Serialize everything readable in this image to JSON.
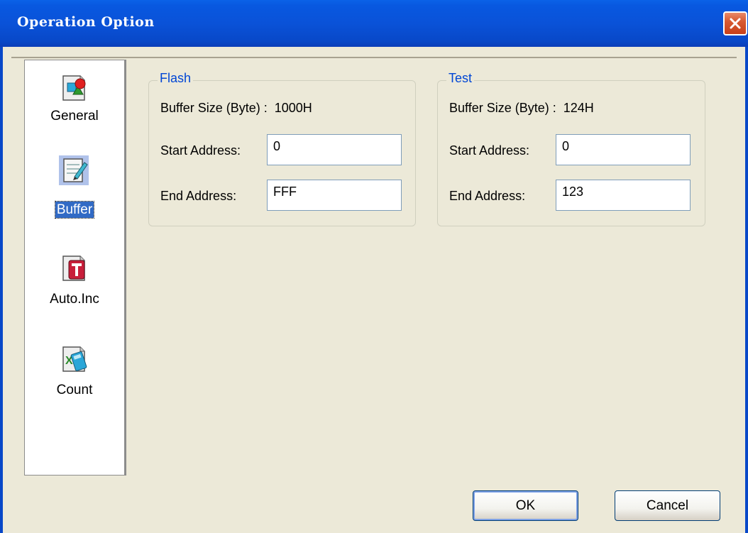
{
  "window": {
    "title": "Operation Option",
    "close_icon": "close-icon"
  },
  "sidebar": {
    "items": [
      {
        "label": "General",
        "icon": "shapes-icon",
        "selected": false
      },
      {
        "label": "Buffer",
        "icon": "notepad-pencil-icon",
        "selected": true
      },
      {
        "label": "Auto.Inc",
        "icon": "letter-t-icon",
        "selected": false
      },
      {
        "label": "Count",
        "icon": "spreadsheet-calculator-icon",
        "selected": false
      }
    ]
  },
  "flash": {
    "title": "Flash",
    "buffer_size_label": "Buffer Size (Byte) :",
    "buffer_size_value": "1000H",
    "start_label": "Start Address:",
    "start_value": "0",
    "end_label": "End Address:",
    "end_value": "FFF"
  },
  "test": {
    "title": "Test",
    "buffer_size_label": "Buffer Size (Byte) :",
    "buffer_size_value": "124H",
    "start_label": "Start Address:",
    "start_value": "0",
    "end_label": "End Address:",
    "end_value": "123"
  },
  "buttons": {
    "ok": "OK",
    "cancel": "Cancel"
  },
  "colors": {
    "titlebar": "#0a52d8",
    "group_title": "#0046d5",
    "selection": "#316ac5",
    "dialog_bg": "#ece9d8"
  }
}
